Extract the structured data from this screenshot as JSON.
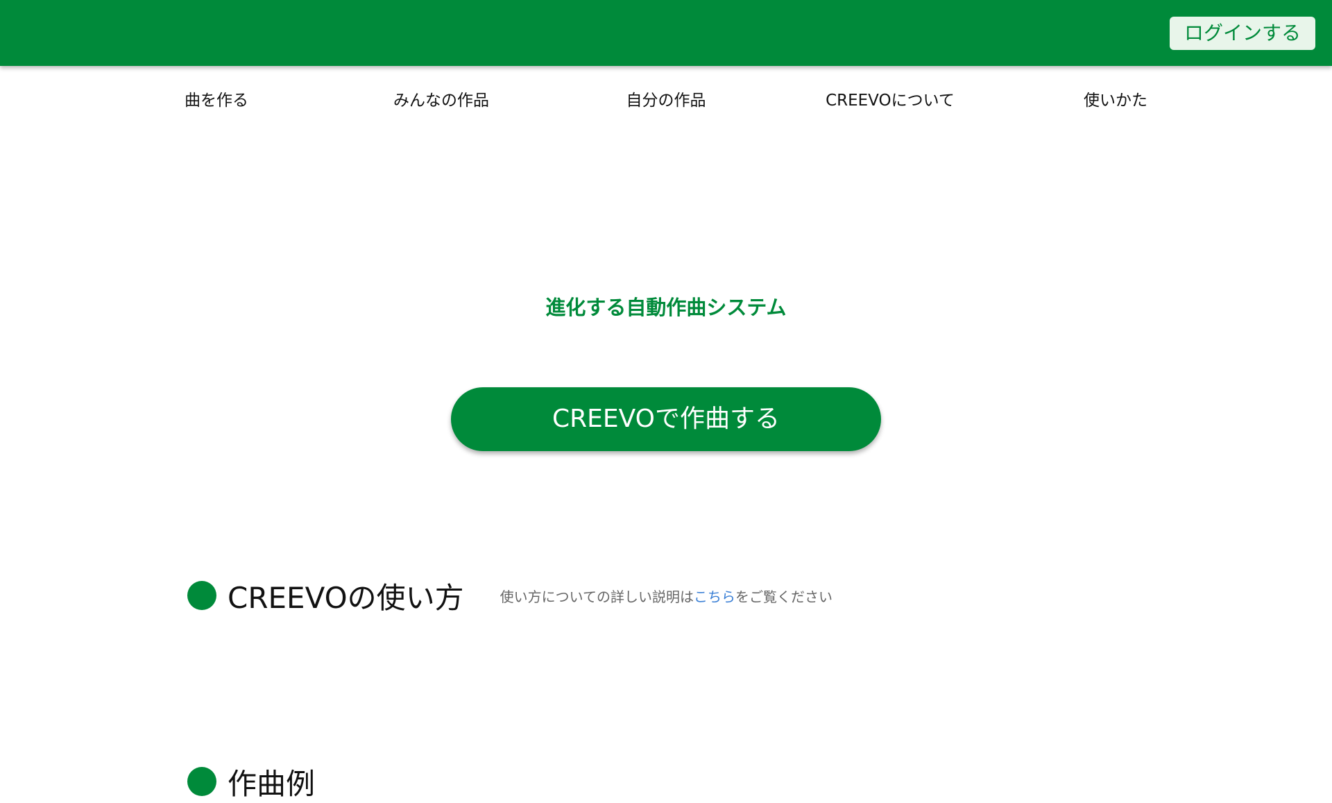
{
  "header": {
    "login_label": "ログインする"
  },
  "nav": {
    "items": [
      {
        "label": "曲を作る"
      },
      {
        "label": "みんなの作品"
      },
      {
        "label": "自分の作品"
      },
      {
        "label": "CREEVOについて"
      },
      {
        "label": "使いかた"
      }
    ]
  },
  "hero": {
    "tagline": "進化する自動作曲システム",
    "cta_label": "CREEVOで作曲する"
  },
  "sections": {
    "howto": {
      "title": "CREEVOの使い方",
      "note_prefix": "使い方についての詳しい説明は",
      "note_link": "こちら",
      "note_suffix": "をご覧ください"
    },
    "examples": {
      "title": "作曲例"
    }
  },
  "colors": {
    "brand_green": "#008a3a",
    "link_blue": "#3a7fd5"
  }
}
